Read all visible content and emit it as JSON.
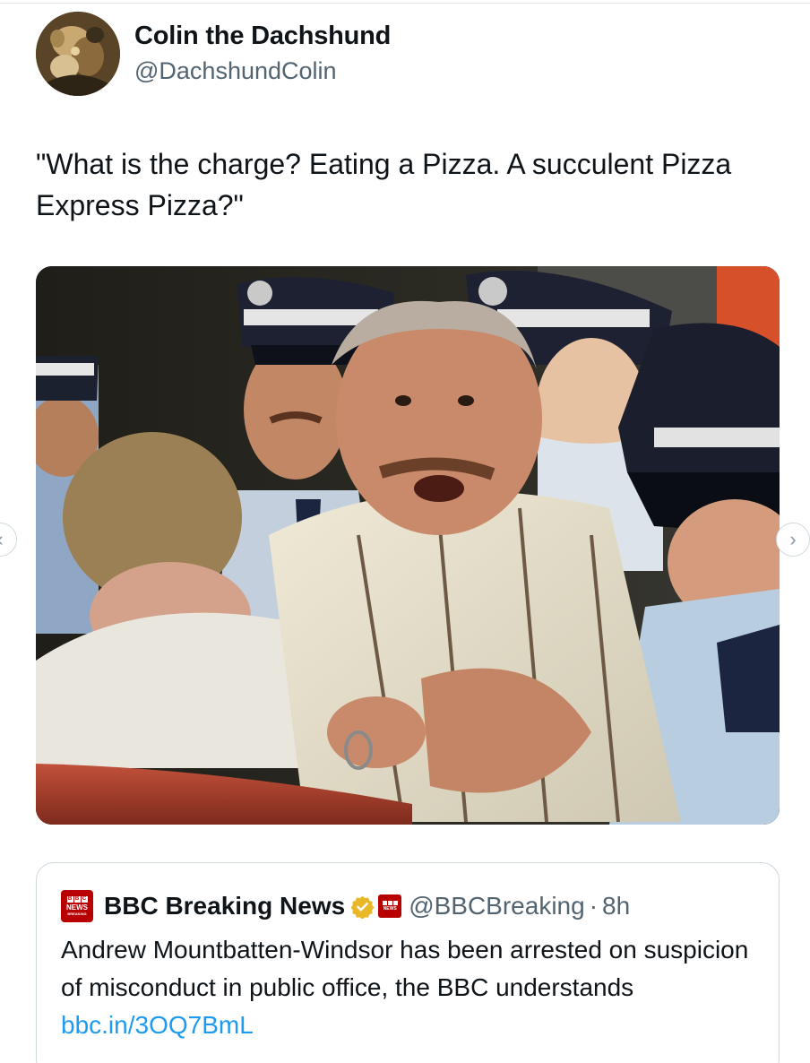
{
  "author": {
    "display_name": "Colin the Dachshund",
    "handle": "@DachshundColin",
    "avatar_icon": "painting-avatar-icon"
  },
  "tweet": {
    "text": "\"What is the charge? Eating a Pizza. A succulent Pizza Express Pizza?\""
  },
  "media": {
    "icon": "news-photo-arrest-image",
    "carousel_prev_icon": "chevron-left-icon",
    "carousel_next_icon": "chevron-right-icon",
    "carousel_prev_glyph": "‹",
    "carousel_next_glyph": "›"
  },
  "quoted_tweet": {
    "display_name": "BBC Breaking News",
    "handle": "@BBCBreaking",
    "separator": "·",
    "time": "8h",
    "text": "Andrew Mountbatten-Windsor has been arrested on suspicion of misconduct in public office, the BBC understands ",
    "link": "bbc.in/3OQ7BmL",
    "logo_text": "NEWS",
    "logo_subtext": "BREAKING",
    "verified_icon": "verified-gold-badge-icon",
    "affiliate_icon": "bbc-news-affiliate-icon"
  },
  "colors": {
    "link": "#1d9bf0",
    "secondary_text": "#536471",
    "bbc_red": "#b80000",
    "verified_gold": "#e8b829"
  }
}
